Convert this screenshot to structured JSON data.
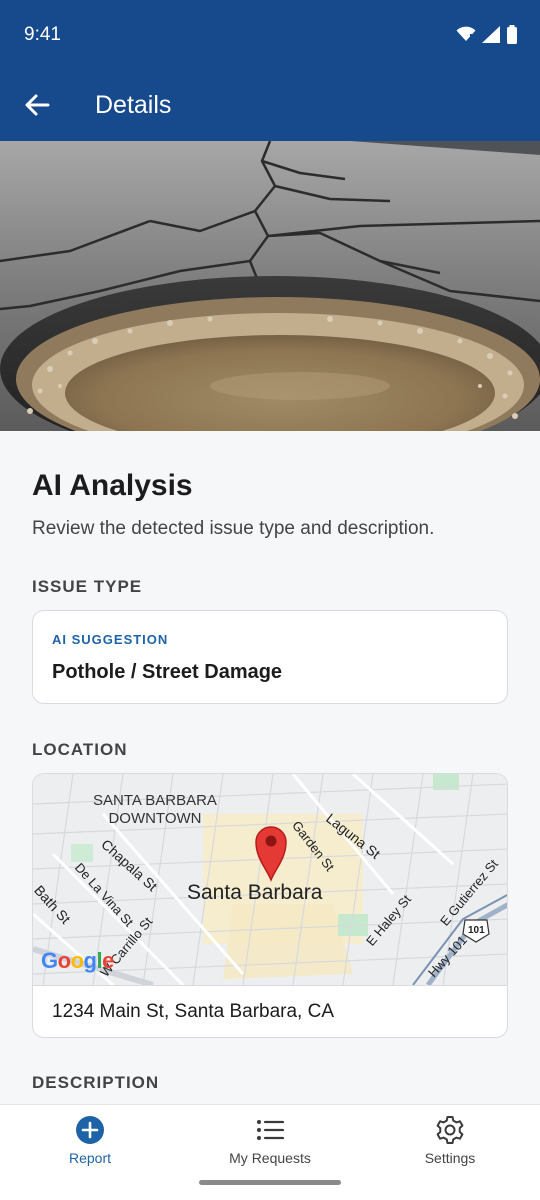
{
  "status_bar": {
    "time": "9:41"
  },
  "app_bar": {
    "title": "Details"
  },
  "analysis": {
    "title": "AI Analysis",
    "subtitle": "Review the detected issue type and description."
  },
  "issue_type": {
    "label": "ISSUE TYPE",
    "tag": "AI SUGGESTION",
    "value": "Pothole / Street Damage"
  },
  "location": {
    "label": "LOCATION",
    "map": {
      "downtown_line1": "SANTA BARBARA",
      "downtown_line2": "DOWNTOWN",
      "city": "Santa Barbara",
      "streets": [
        "Laguna St",
        "Garden St",
        "Chapala St",
        "De La Vina St",
        "Bath St",
        "E Haley St",
        "E Gutierrez St",
        "Hwy 101",
        "W Carrillo St"
      ],
      "highway_shield": "101",
      "attribution": "Google"
    },
    "address": "1234 Main St, Santa Barbara, CA"
  },
  "description": {
    "label": "DESCRIPTION"
  },
  "nav": [
    {
      "label": "Report",
      "icon": "add-circle-icon",
      "active": true
    },
    {
      "label": "My Requests",
      "icon": "list-icon",
      "active": false
    },
    {
      "label": "Settings",
      "icon": "gear-icon",
      "active": false
    }
  ],
  "colors": {
    "primary": "#174a8c",
    "accent": "#1e63a8",
    "background": "#f6f7f9"
  }
}
